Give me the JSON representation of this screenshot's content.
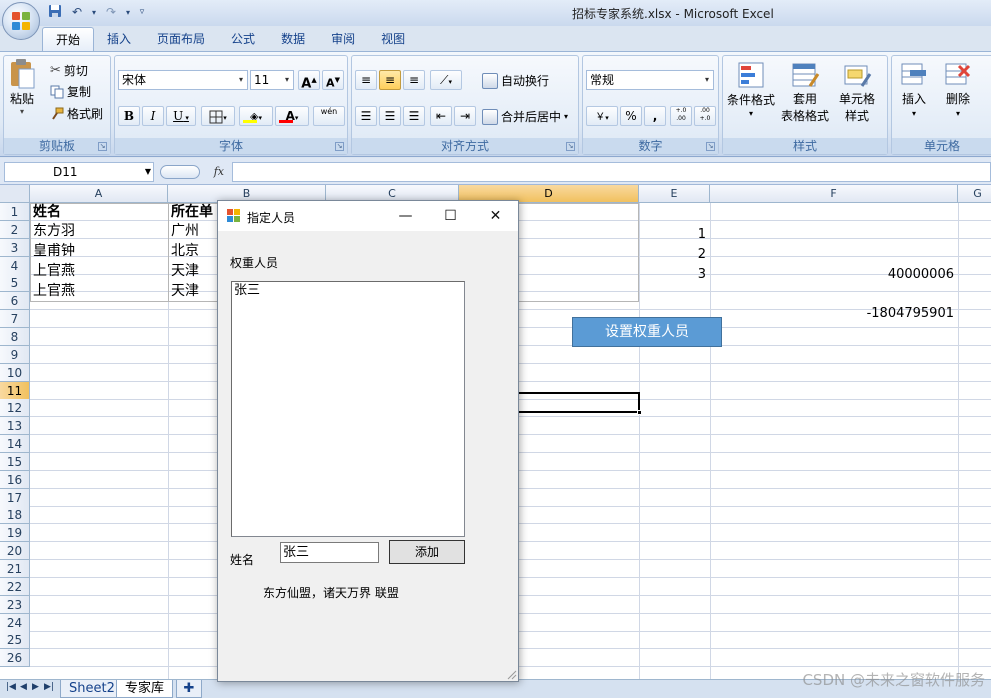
{
  "window": {
    "title": "招标专家系统.xlsx - Microsoft Excel"
  },
  "quick_access": {
    "icons": [
      "save-icon",
      "undo-icon",
      "redo-icon",
      "customize-icon"
    ]
  },
  "ribbon": {
    "tabs": [
      "开始",
      "插入",
      "页面布局",
      "公式",
      "数据",
      "审阅",
      "视图"
    ],
    "active_tab": "开始",
    "clipboard": {
      "label": "剪贴板",
      "paste": "粘贴",
      "cut": "剪切",
      "copy": "复制",
      "format_painter": "格式刷"
    },
    "font": {
      "label": "字体",
      "font_name": "宋体",
      "font_size": "11",
      "grow": "A",
      "shrink": "A",
      "bold": "B",
      "italic": "I",
      "underline": "U",
      "font_color_letter": "A",
      "phonetic_letter": "wén"
    },
    "alignment": {
      "label": "对齐方式",
      "wrap_text": "自动换行",
      "merge_center": "合并后居中"
    },
    "number": {
      "label": "数字",
      "format": "常规",
      "percent": "%",
      "comma": ",",
      "dec_increase": "+.0 .00",
      "dec_decrease": ".00 +.0"
    },
    "styles": {
      "label": "样式",
      "conditional_line1": "条件格式",
      "table_format_line1": "套用",
      "table_format_line2": "表格格式",
      "cell_styles_line1": "单元格",
      "cell_styles_line2": "样式"
    },
    "cells": {
      "label": "单元格",
      "insert": "插入",
      "delete": "删除"
    },
    "colors": {
      "accent": "#15428b",
      "font_color_bar": "#ff0000",
      "fill_color_bar": "#ffff00"
    }
  },
  "formula_bar": {
    "name_box": "D11",
    "fx": "fx",
    "value": ""
  },
  "grid": {
    "columns": [
      "A",
      "B",
      "C",
      "D",
      "E",
      "F",
      "G"
    ],
    "selected_column": "D",
    "rows": [
      "1",
      "2",
      "3",
      "4",
      "5",
      "6",
      "7",
      "8",
      "9",
      "10",
      "11",
      "12",
      "13",
      "14",
      "15",
      "16",
      "17",
      "18",
      "19",
      "20",
      "21",
      "22",
      "23",
      "24",
      "25",
      "26"
    ],
    "selected_row": "11",
    "cells": {
      "A1": "姓名",
      "B1": "所在单",
      "A2": "东方羽",
      "B2": "广州",
      "A3": "皇甫钟",
      "B3": "北京",
      "A4": "上官燕",
      "B4": "天津",
      "A5": "上官燕",
      "B5": "天津",
      "E2": "1",
      "E3": "2",
      "E4": "3",
      "F4": "40000006",
      "F6": "-1804795901"
    },
    "sheet_button": "设置权重人员"
  },
  "sheet_tabs": {
    "tabs": [
      "Sheet2",
      "专家库"
    ],
    "active": "专家库"
  },
  "watermark": "CSDN @未来之窗软件服务",
  "dialog": {
    "title": "指定人员",
    "list_label": "权重人员",
    "list_items": [
      "张三"
    ],
    "name_label": "姓名",
    "name_value": "张三",
    "add_button": "添加",
    "footer_text": "东方仙盟，诸天万界 联盟"
  }
}
